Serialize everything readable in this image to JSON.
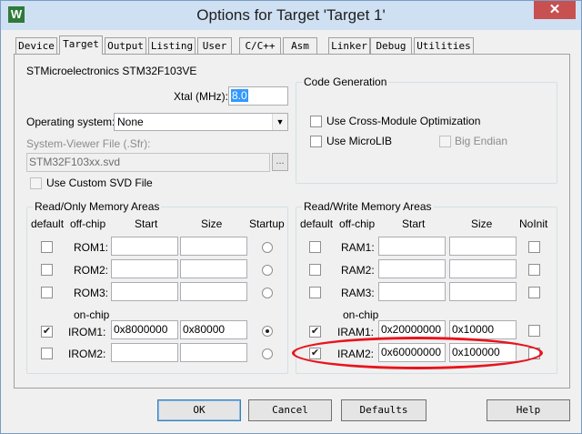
{
  "window": {
    "title": "Options for Target 'Target 1'",
    "app_icon_letter": "W",
    "close_glyph": "✕"
  },
  "tabs": [
    "Device",
    "Target",
    "Output",
    "Listing",
    "User",
    "C/C++",
    "Asm",
    "Linker",
    "Debug",
    "Utilities"
  ],
  "device_name": "STMicroelectronics STM32F103VE",
  "xtal": {
    "label": "Xtal (MHz):",
    "value": "8.0"
  },
  "os": {
    "label": "Operating system:",
    "value": "None"
  },
  "svd": {
    "label": "System-Viewer File (.Sfr):",
    "value": "STM32F103xx.svd",
    "browse": "...",
    "custom_label": "Use Custom SVD File"
  },
  "code_gen": {
    "title": "Code Generation",
    "cross_module": "Use Cross-Module Optimization",
    "microlib": "Use MicroLIB",
    "big_endian": "Big Endian"
  },
  "ro": {
    "title": "Read/Only Memory Areas",
    "headers": {
      "default": "default",
      "offchip": "off-chip",
      "start": "Start",
      "size": "Size",
      "startup": "Startup"
    },
    "onchip_label": "on-chip",
    "rows": [
      {
        "name": "ROM1:",
        "start": "",
        "size": "",
        "checked": false,
        "startup": false
      },
      {
        "name": "ROM2:",
        "start": "",
        "size": "",
        "checked": false,
        "startup": false
      },
      {
        "name": "ROM3:",
        "start": "",
        "size": "",
        "checked": false,
        "startup": false
      },
      {
        "name": "IROM1:",
        "start": "0x8000000",
        "size": "0x80000",
        "checked": true,
        "startup": true
      },
      {
        "name": "IROM2:",
        "start": "",
        "size": "",
        "checked": false,
        "startup": false
      }
    ]
  },
  "rw": {
    "title": "Read/Write Memory Areas",
    "headers": {
      "default": "default",
      "offchip": "off-chip",
      "start": "Start",
      "size": "Size",
      "noinit": "NoInit"
    },
    "onchip_label": "on-chip",
    "rows": [
      {
        "name": "RAM1:",
        "start": "",
        "size": "",
        "checked": false
      },
      {
        "name": "RAM2:",
        "start": "",
        "size": "",
        "checked": false
      },
      {
        "name": "RAM3:",
        "start": "",
        "size": "",
        "checked": false
      },
      {
        "name": "IRAM1:",
        "start": "0x20000000",
        "size": "0x10000",
        "checked": true
      },
      {
        "name": "IRAM2:",
        "start": "0x60000000",
        "size": "0x100000",
        "checked": true
      }
    ]
  },
  "buttons": {
    "ok": "OK",
    "cancel": "Cancel",
    "defaults": "Defaults",
    "help": "Help"
  },
  "colors": {
    "highlight_ellipse": "#e8141e",
    "selection": "#3399ff"
  }
}
